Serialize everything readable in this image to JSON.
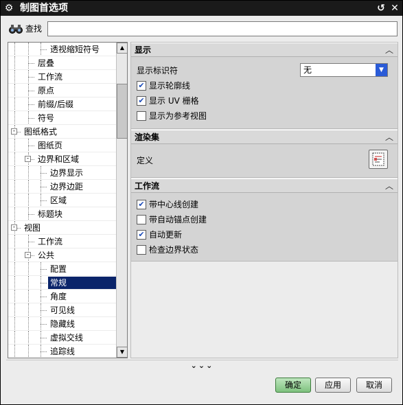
{
  "window": {
    "title": "制图首选项"
  },
  "search": {
    "label": "查找",
    "value": "",
    "placeholder": ""
  },
  "tree": {
    "items": [
      {
        "label": "透视缩短符号",
        "depth": 3,
        "toggle": ""
      },
      {
        "label": "层叠",
        "depth": 2,
        "toggle": ""
      },
      {
        "label": "工作流",
        "depth": 2,
        "toggle": ""
      },
      {
        "label": "原点",
        "depth": 2,
        "toggle": ""
      },
      {
        "label": "前缀/后缀",
        "depth": 2,
        "toggle": ""
      },
      {
        "label": "符号",
        "depth": 2,
        "toggle": ""
      },
      {
        "label": "图纸格式",
        "depth": 1,
        "toggle": "-"
      },
      {
        "label": "图纸页",
        "depth": 2,
        "toggle": ""
      },
      {
        "label": "边界和区域",
        "depth": 2,
        "toggle": "-"
      },
      {
        "label": "边界显示",
        "depth": 3,
        "toggle": ""
      },
      {
        "label": "边界边距",
        "depth": 3,
        "toggle": ""
      },
      {
        "label": "区域",
        "depth": 3,
        "toggle": ""
      },
      {
        "label": "标题块",
        "depth": 2,
        "toggle": ""
      },
      {
        "label": "视图",
        "depth": 1,
        "toggle": "-"
      },
      {
        "label": "工作流",
        "depth": 2,
        "toggle": ""
      },
      {
        "label": "公共",
        "depth": 2,
        "toggle": "-"
      },
      {
        "label": "配置",
        "depth": 3,
        "toggle": ""
      },
      {
        "label": "常规",
        "depth": 3,
        "toggle": "",
        "selected": true
      },
      {
        "label": "角度",
        "depth": 3,
        "toggle": ""
      },
      {
        "label": "可见线",
        "depth": 3,
        "toggle": ""
      },
      {
        "label": "隐藏线",
        "depth": 3,
        "toggle": ""
      },
      {
        "label": "虚拟交线",
        "depth": 3,
        "toggle": ""
      },
      {
        "label": "追踪线",
        "depth": 3,
        "toggle": ""
      }
    ]
  },
  "display": {
    "title": "显示",
    "marker_label": "显示标识符",
    "marker_value": "无",
    "checkboxes": [
      {
        "label": "显示轮廓线",
        "checked": true
      },
      {
        "label": "显示 UV 栅格",
        "checked": true
      },
      {
        "label": "显示为参考视图",
        "checked": false
      }
    ]
  },
  "render_set": {
    "title": "渲染集",
    "define_label": "定义"
  },
  "workflow": {
    "title": "工作流",
    "checkboxes": [
      {
        "label": "带中心线创建",
        "checked": true
      },
      {
        "label": "带自动锚点创建",
        "checked": false
      },
      {
        "label": "自动更新",
        "checked": true
      },
      {
        "label": "检查边界状态",
        "checked": false
      }
    ]
  },
  "footer": {
    "more_glyph": "⌄⌄⌄",
    "ok_label": "确定",
    "apply_label": "应用",
    "cancel_label": "取消"
  },
  "icons": {
    "title": "gear-icon",
    "reset": "reset-icon",
    "close": "close-icon",
    "search": "binoculars-icon",
    "collapse": "chevron-up-icon",
    "define": "define-icon"
  },
  "colors": {
    "selection": "#0a246a",
    "ok_button": "#7ec27e",
    "check": "#1a4ab8",
    "dropdown_arrow": "#2a5bd7"
  }
}
